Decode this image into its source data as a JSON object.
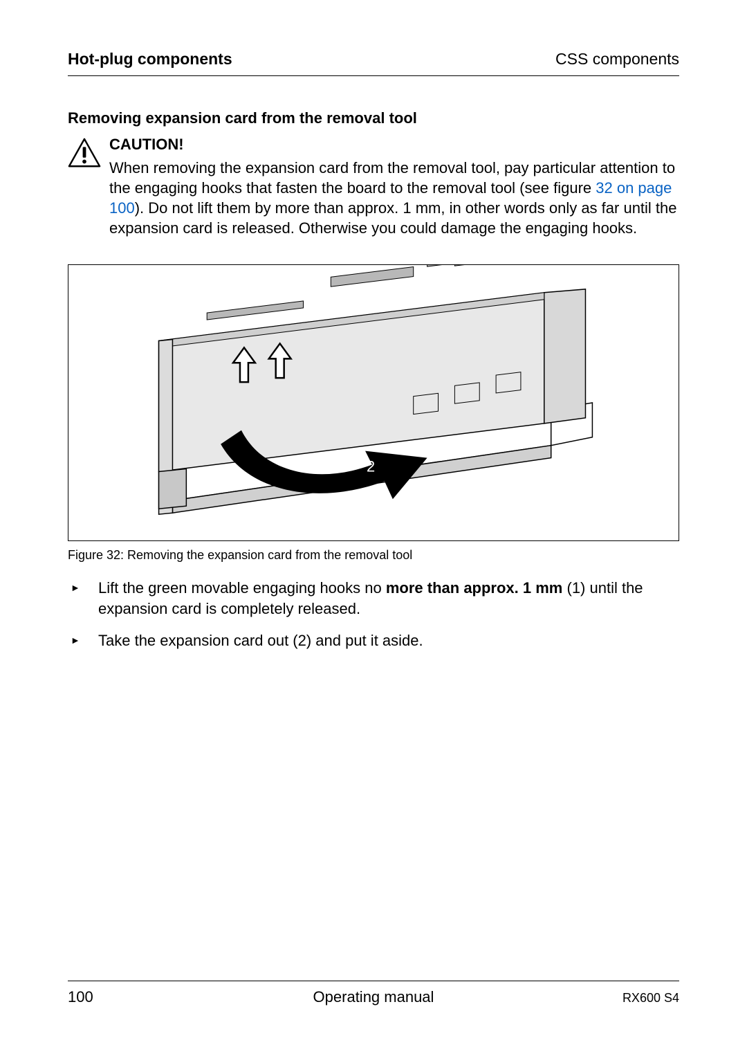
{
  "header": {
    "left": "Hot-plug components",
    "right": "CSS components"
  },
  "section_subtitle": "Removing expansion card from the removal tool",
  "caution": {
    "title": "CAUTION!",
    "body_before_link": "When removing the expansion card from the removal tool, pay particular attention to the engaging hooks that fasten the board to the removal tool (see figure ",
    "link_text": "32 on page 100",
    "body_after_link": "). Do not lift them by more than approx. 1 mm, in other words only as far until the expansion card is released. Otherwise you could damage the engaging hooks."
  },
  "figure": {
    "arrow_label": "2",
    "caption": "Figure 32: Removing the expansion card from the removal tool"
  },
  "steps": {
    "step1_pre": "Lift the green movable engaging hooks no ",
    "step1_bold": "more than approx. 1 mm",
    "step1_post": " (1) until the expansion card is completely released.",
    "step2": "Take the expansion card out (2) and put it aside."
  },
  "footer": {
    "page_number": "100",
    "center": "Operating manual",
    "model": "RX600 S4"
  }
}
